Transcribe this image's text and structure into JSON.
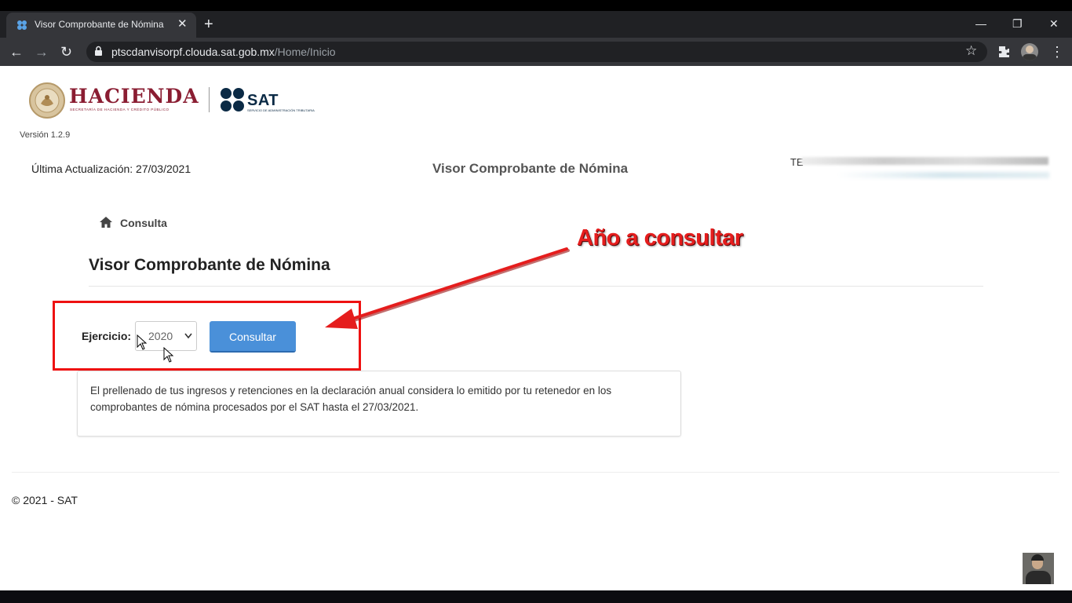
{
  "browser": {
    "tab_title": "Visor Comprobante de Nómina",
    "tab_close": "✕",
    "new_tab": "+",
    "url_host": "ptscdanvisorpf.clouda.sat.gob.mx",
    "url_path": "/Home/Inicio",
    "back_icon": "←",
    "forward_icon": "→",
    "reload_icon": "↻",
    "star_icon": "☆",
    "menu_icon": "⋮",
    "minimize_icon": "—",
    "restore_icon": "❐",
    "close_icon": "✕"
  },
  "header": {
    "logo_hacienda": "HACIENDA",
    "logo_hacienda_sub": "SECRETARÍA DE HACIENDA Y CRÉDITO PÚBLICO",
    "logo_sat": "SAT",
    "logo_sat_sub": "SERVICIO DE ADMINISTRACIÓN TRIBUTARIA",
    "version": "Versión 1.2.9",
    "last_update": "Última Actualización: 27/03/2021",
    "app_title": "Visor Comprobante de Nómina",
    "user_label": "TE"
  },
  "breadcrumb": {
    "label": "Consulta"
  },
  "main": {
    "section_title": "Visor Comprobante de Nómina",
    "ejercicio_label": "Ejercicio:",
    "ejercicio_value": "2020",
    "consultar_label": "Consultar",
    "info_text": "El prellenado de tus ingresos y retenciones en la declaración anual considera lo emitido por tu retenedor en los comprobantes de nómina procesados por el SAT hasta el 27/03/2021."
  },
  "footer": {
    "copyright": "© 2021 - SAT"
  },
  "annotation": {
    "callout": "Año a consultar",
    "color": "#e51d1d"
  },
  "colors": {
    "hacienda": "#8a1d32",
    "sat": "#0b2a45",
    "button": "#4a90d9"
  }
}
